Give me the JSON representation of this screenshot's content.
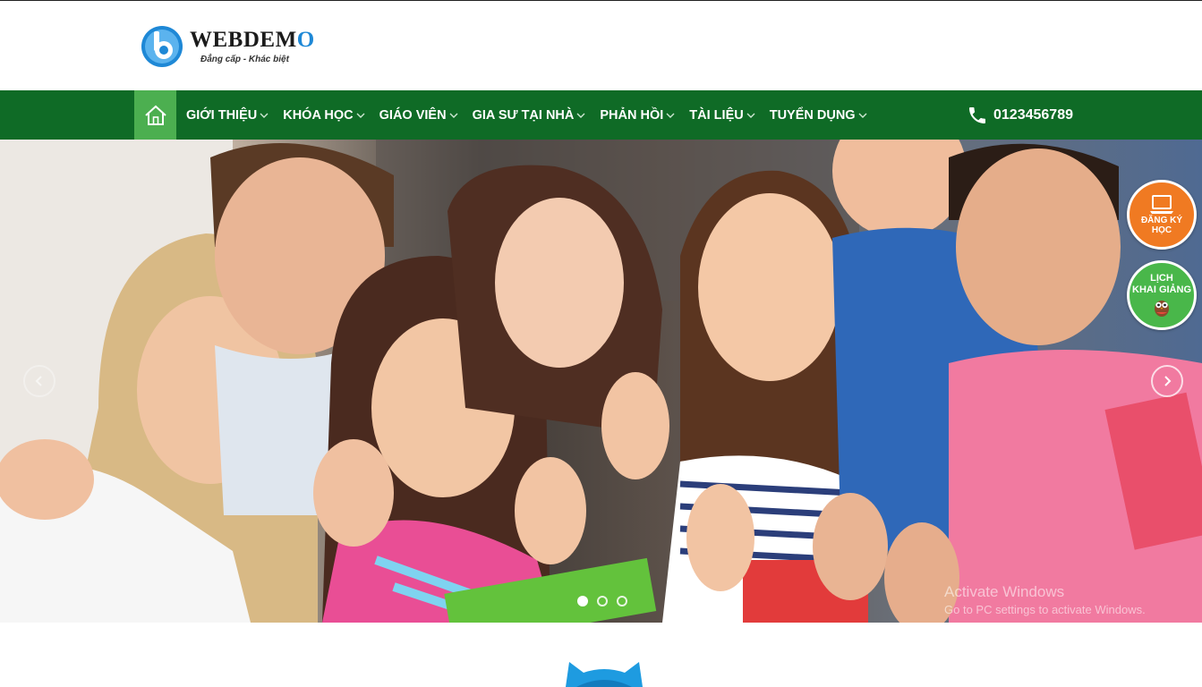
{
  "header": {
    "logo_name_main": "WEBDEM",
    "logo_name_accent": "O",
    "logo_tagline": "Đẳng cấp - Khác biệt"
  },
  "nav": {
    "home_icon": "home-icon",
    "items": [
      {
        "label": "GIỚI THIỆU"
      },
      {
        "label": "KHÓA HỌC"
      },
      {
        "label": "GIÁO VIÊN"
      },
      {
        "label": "GIA SƯ TẠI NHÀ"
      },
      {
        "label": "PHẢN HỒI"
      },
      {
        "label": "TÀI LIỆU"
      },
      {
        "label": "TUYỂN DỤNG"
      }
    ],
    "phone": "0123456789",
    "phone_icon": "phone-icon"
  },
  "hero": {
    "slides_count": 3,
    "active_slide": 1
  },
  "badges": {
    "register": {
      "line1": "ĐĂNG KÝ",
      "line2": "HỌC"
    },
    "schedule": {
      "line1": "LỊCH",
      "line2": "KHAI GIẢNG"
    }
  },
  "watermark": {
    "title": "Activate Windows",
    "subtitle": "Go to PC settings to activate Windows."
  },
  "colors": {
    "nav_bg": "#0f6b26",
    "nav_home_bg": "#4caf50",
    "logo_blue": "#1e88d6",
    "register_badge": "#f07a22",
    "schedule_badge": "#49b74a"
  }
}
